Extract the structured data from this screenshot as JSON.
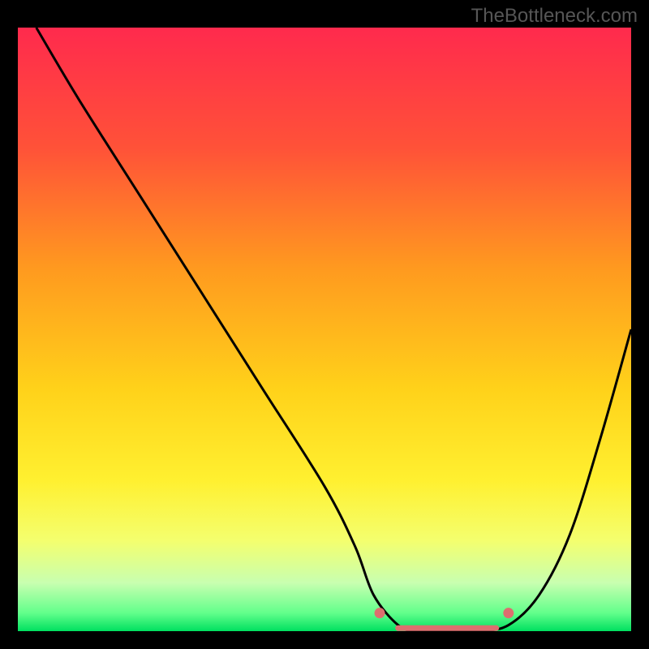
{
  "watermark": "TheBottleneck.com",
  "chart_data": {
    "type": "line",
    "title": "",
    "xlabel": "",
    "ylabel": "",
    "xlim": [
      0,
      100
    ],
    "ylim": [
      0,
      100
    ],
    "series": [
      {
        "name": "bottleneck-curve",
        "x": [
          3,
          10,
          20,
          30,
          40,
          50,
          55,
          58,
          62,
          65,
          70,
          75,
          80,
          85,
          90,
          95,
          100
        ],
        "y": [
          100,
          88,
          72,
          56,
          40,
          24,
          14,
          6,
          1,
          0,
          0,
          0,
          1,
          6,
          16,
          32,
          50
        ],
        "color": "#000000"
      }
    ],
    "markers": [
      {
        "name": "point-left",
        "x": 59,
        "y": 3,
        "color": "#dd6f6f"
      },
      {
        "name": "point-right",
        "x": 80,
        "y": 3,
        "color": "#dd6f6f"
      }
    ],
    "flat_segment": {
      "x0": 62,
      "x1": 78,
      "y": 0.5,
      "color": "#dd6f6f"
    },
    "background_gradient": {
      "stops": [
        {
          "offset": 0.0,
          "color": "#ff2a4d"
        },
        {
          "offset": 0.2,
          "color": "#ff5238"
        },
        {
          "offset": 0.4,
          "color": "#ff9a1f"
        },
        {
          "offset": 0.6,
          "color": "#ffd21a"
        },
        {
          "offset": 0.75,
          "color": "#fff030"
        },
        {
          "offset": 0.85,
          "color": "#f4ff6e"
        },
        {
          "offset": 0.92,
          "color": "#c8ffb0"
        },
        {
          "offset": 0.97,
          "color": "#62ff8b"
        },
        {
          "offset": 1.0,
          "color": "#00e060"
        }
      ]
    }
  }
}
